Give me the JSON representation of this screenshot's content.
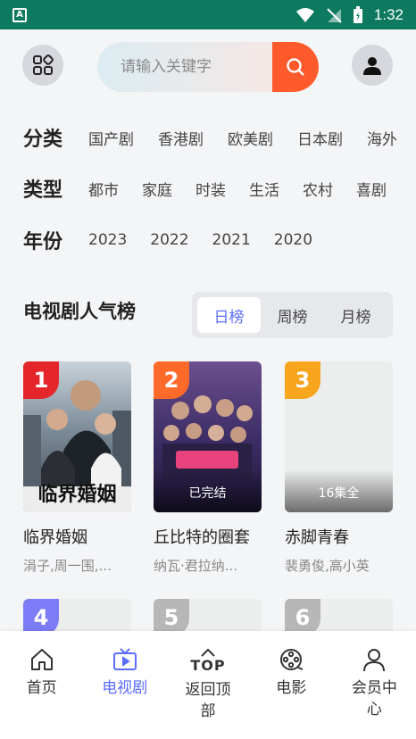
{
  "status_bar": {
    "time": "1:32",
    "app_badge": "A"
  },
  "search": {
    "placeholder": "请输入关键字"
  },
  "filters": {
    "category": {
      "label": "分类",
      "options": [
        "国产剧",
        "香港剧",
        "欧美剧",
        "日本剧",
        "海外"
      ]
    },
    "genre": {
      "label": "类型",
      "options": [
        "都市",
        "家庭",
        "时装",
        "生活",
        "农村",
        "喜剧"
      ]
    },
    "year": {
      "label": "年份",
      "options": [
        "2023",
        "2022",
        "2021",
        "2020"
      ]
    }
  },
  "ranking": {
    "title": "电视剧人气榜",
    "tabs": [
      "日榜",
      "周榜",
      "月榜"
    ],
    "active_tab": "日榜",
    "items": [
      {
        "rank": "1",
        "title": "临界婚姻",
        "actors": "涓子,周一围,...",
        "status": "",
        "badge_color": "#e4262a",
        "poster_text": "临界婚姻"
      },
      {
        "rank": "2",
        "title": "丘比特的圈套",
        "actors": "纳瓦·君拉纳...",
        "status": "已完结",
        "badge_color": "#ff6a2b"
      },
      {
        "rank": "3",
        "title": "赤脚青春",
        "actors": "裴勇俊,高小英",
        "status": "16集全",
        "badge_color": "#f7a51c"
      }
    ],
    "next_items": [
      {
        "rank": "4",
        "badge_color": "#7b7cf6"
      },
      {
        "rank": "5",
        "badge_color": "#b7b7b7"
      },
      {
        "rank": "6",
        "badge_color": "#b7b7b7"
      }
    ]
  },
  "bottom_nav": [
    {
      "label": "首页",
      "icon": "home-icon"
    },
    {
      "label": "电视剧",
      "icon": "tv-icon",
      "active": true
    },
    {
      "label": "返回顶部",
      "icon": "back-to-top-icon",
      "top_text": "TOP"
    },
    {
      "label": "电影",
      "icon": "film-reel-icon"
    },
    {
      "label": "会员中心",
      "icon": "user-icon"
    }
  ],
  "colors": {
    "accent": "#5b6cff",
    "search_button": "#ff5a2b",
    "status_bar": "#0d7a5f"
  }
}
